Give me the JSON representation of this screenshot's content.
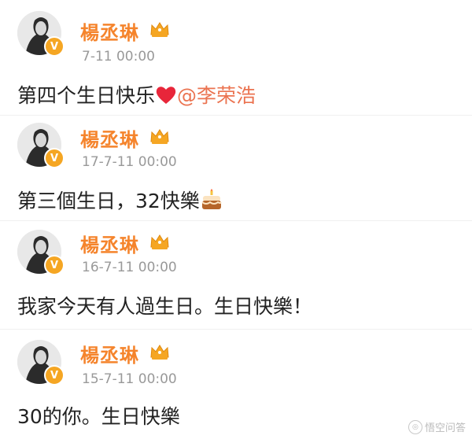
{
  "posts": [
    {
      "username": "楊丞琳",
      "timestamp": "7-11 00:00",
      "text": "第四个生日快乐",
      "emoji": "heart",
      "mention": "@李荣浩"
    },
    {
      "username": "楊丞琳",
      "timestamp": "17-7-11 00:00",
      "text": "第三個生日，32快樂",
      "emoji": "cake"
    },
    {
      "username": "楊丞琳",
      "timestamp": "16-7-11 00:00",
      "text": "我家今天有人過生日。生日快樂！"
    },
    {
      "username": "楊丞琳",
      "timestamp": "15-7-11 00:00",
      "text": "30的你。生日快樂"
    }
  ],
  "badge": {
    "letter": "V",
    "color": "#f5a623"
  },
  "colors": {
    "username": "#f5842c",
    "timestamp": "#999999",
    "text": "#222222",
    "mention": "#eb7350"
  },
  "icons": {
    "verified": "v-badge-icon",
    "member": "crown-icon",
    "heart": "heart-icon",
    "cake": "cake-icon"
  },
  "watermark": {
    "text": "悟空问答"
  }
}
